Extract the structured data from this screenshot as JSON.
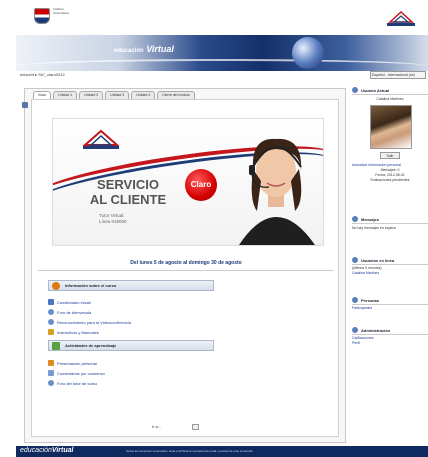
{
  "header": {
    "institution_text": "Instituto Colombiano",
    "banner_brand": "educación",
    "banner_brand_bold": "Virtual"
  },
  "breadcrumb": "educvirt ▸ SIC_claro2012",
  "lang_select": "Español - Internacional (es)",
  "tabs": [
    "Inicio",
    "Unidad 1",
    "Unidad 2",
    "Unidad 3",
    "Unidad 4",
    "Cierre del módulo"
  ],
  "promo": {
    "title_line1": "SERVICIO",
    "title_line2": "AL CLIENTE",
    "sub1": "Tutor Virtual:",
    "sub2": "Línea 018000",
    "claro_badge": "Claro"
  },
  "dates": "Del lunes 5 de agosto al domingo 30 de agosto",
  "section1": {
    "title": "Información sobre el curso",
    "items": [
      "Cuestionario inicial",
      "Foro de bienvenida",
      "Reconocimiento para la Videoconferencia",
      "Instructivos y Manuales"
    ]
  },
  "section2": {
    "title": "Actividades de aprendizaje",
    "items": [
      "Presentación personal",
      "Comentarios por consenso",
      "Foro del tutor de curso"
    ]
  },
  "pager": "Ir a...",
  "sidebar": {
    "user": {
      "title": "Usuario Actual",
      "name": "Catalina Martinez",
      "button": "Salir",
      "lines": [
        "Actualizar información personal",
        "Mensajes: 0",
        "Fecha: 2012-08-01",
        "Evaluaciones pendientes"
      ]
    },
    "messages": {
      "title": "Mensajes",
      "text": "No hay mensajes en espera"
    },
    "online": {
      "title": "Usuarios en línea",
      "lines": [
        "(últimos 5 minutos)",
        "Catalina Martinez"
      ]
    },
    "people": {
      "title": "Personas",
      "lines": [
        "Participantes"
      ]
    },
    "admin": {
      "title": "Administración",
      "lines": [
        "Calificaciones",
        "Perfil"
      ]
    }
  },
  "footer": {
    "brand": "educación",
    "brand_bold": "Virtual",
    "text": "Todos los derechos reservados. Está prohibida la reproducción total o parcial de este contenido"
  },
  "colors": {
    "brand_blue": "#0f2a5e",
    "claro_red": "#d40000",
    "link_blue": "#1a3a9a"
  }
}
